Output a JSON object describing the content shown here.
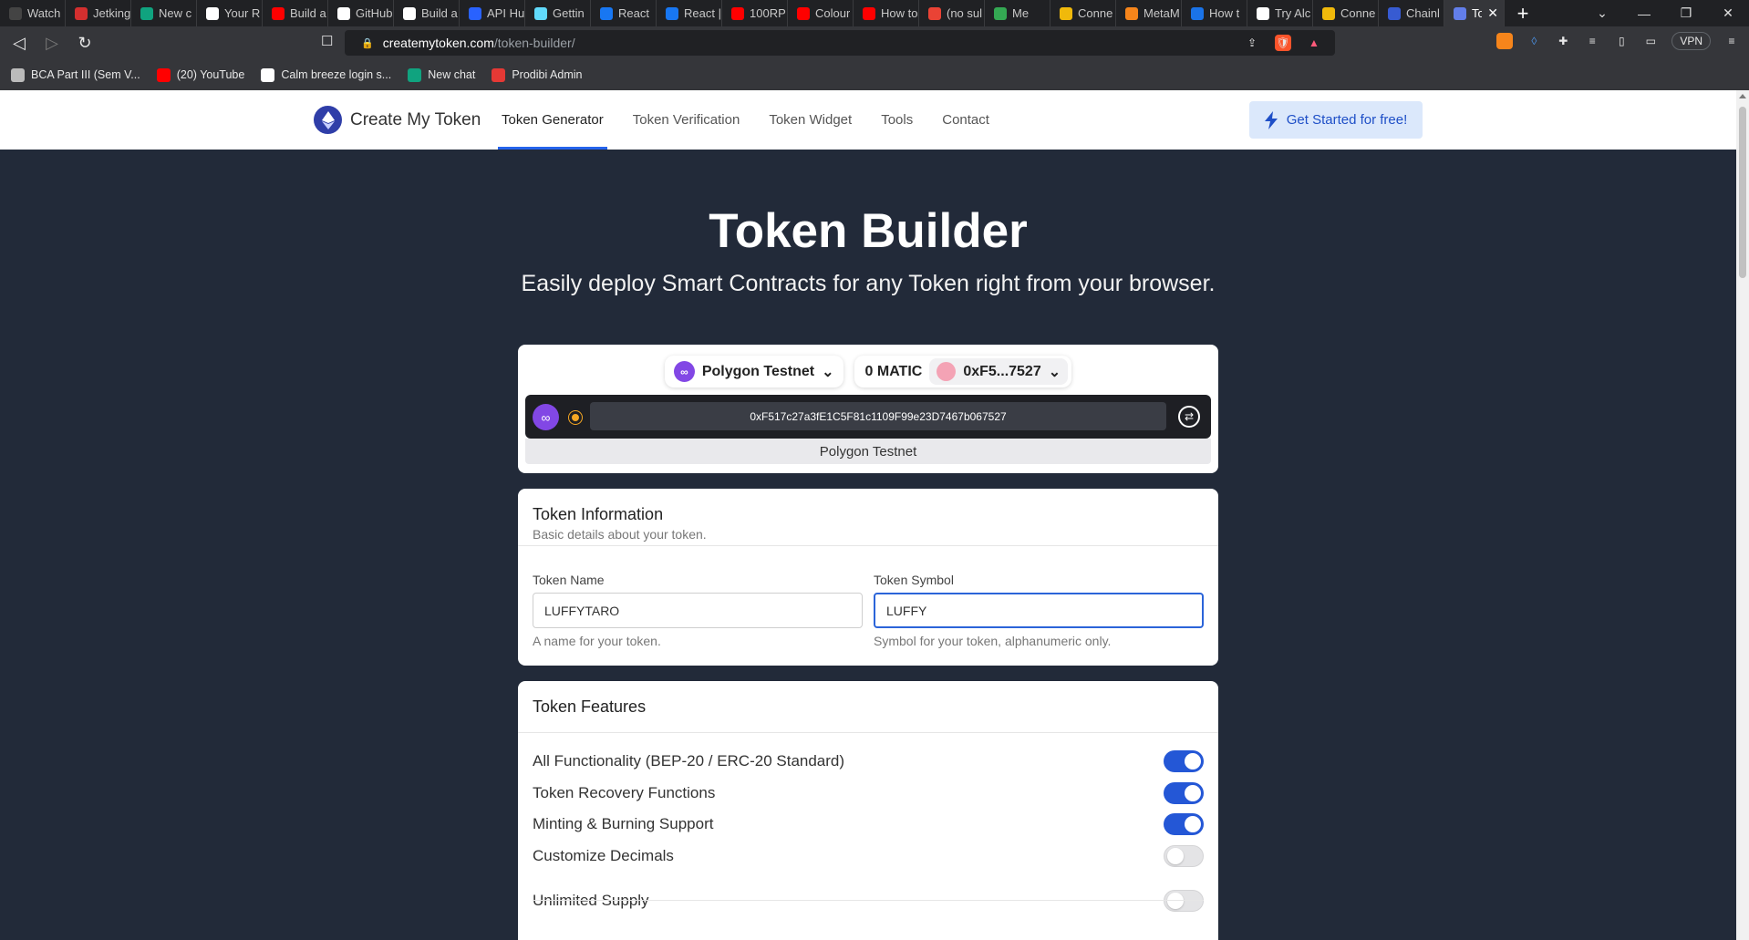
{
  "browser": {
    "tabs": [
      {
        "title": "Watch",
        "color": "#444"
      },
      {
        "title": "Jetking",
        "color": "#d32f2f"
      },
      {
        "title": "New c",
        "color": "#10a37f"
      },
      {
        "title": "Your R",
        "color": "#ffffff"
      },
      {
        "title": "Build a",
        "color": "#ff0000"
      },
      {
        "title": "GitHub",
        "color": "#ffffff"
      },
      {
        "title": "Build a",
        "color": "#ffffff"
      },
      {
        "title": "API Hu",
        "color": "#2962ff"
      },
      {
        "title": "Gettin",
        "color": "#61dafb"
      },
      {
        "title": "React",
        "color": "#1877f2"
      },
      {
        "title": "React |",
        "color": "#1877f2"
      },
      {
        "title": "100RP",
        "color": "#ff0000"
      },
      {
        "title": "Colour",
        "color": "#ff0000"
      },
      {
        "title": "How to",
        "color": "#ff0000"
      },
      {
        "title": "(no sul",
        "color": "#ea4335"
      },
      {
        "title": "Me",
        "color": "#34a853"
      },
      {
        "title": "Conne",
        "color": "#f0b90b"
      },
      {
        "title": "MetaM",
        "color": "#f6851b"
      },
      {
        "title": "How t",
        "color": "#1a73e8"
      },
      {
        "title": "Try Alc",
        "color": "#ffffff"
      },
      {
        "title": "Conne",
        "color": "#f0b90b"
      },
      {
        "title": "Chainl",
        "color": "#375bd2"
      }
    ],
    "active_tab": {
      "title": "Tol"
    },
    "url_host": "createmytoken.com",
    "url_path": "/token-builder/",
    "vpn_label": "VPN",
    "bookmarks": [
      {
        "label": "BCA Part III (Sem V...",
        "color": "#bbbbbb"
      },
      {
        "label": "(20) YouTube",
        "color": "#ff0000"
      },
      {
        "label": "Calm breeze login s...",
        "color": "#ffffff"
      },
      {
        "label": "New chat",
        "color": "#10a37f"
      },
      {
        "label": "Prodibi Admin",
        "color": "#e53935"
      }
    ]
  },
  "site": {
    "brand": "Create My Token",
    "nav": [
      {
        "label": "Token Generator",
        "active": true
      },
      {
        "label": "Token Verification",
        "active": false
      },
      {
        "label": "Token Widget",
        "active": false
      },
      {
        "label": "Tools",
        "active": false
      },
      {
        "label": "Contact",
        "active": false
      }
    ],
    "cta_label": "Get Started for free!",
    "accent": "#2563eb"
  },
  "hero": {
    "title": "Token Builder",
    "subtitle": "Easily deploy Smart Contracts for any Token right from your browser."
  },
  "wallet": {
    "network": "Polygon Testnet",
    "balance": "0 MATIC",
    "account_short": "0xF5...7527",
    "address": "0xF517c27a3fE1C5F81c1109F99e23D7467b067527",
    "network_label": "Polygon Testnet"
  },
  "token_info": {
    "title": "Token Information",
    "subtitle": "Basic details about your token.",
    "name_label": "Token Name",
    "name_value": "LUFFYTARO",
    "name_help": "A name for your token.",
    "symbol_label": "Token Symbol",
    "symbol_value": "LUFFY",
    "symbol_help": "Symbol for your token, alphanumeric only."
  },
  "features": {
    "title": "Token Features",
    "items": [
      {
        "label": "All Functionality (BEP-20 / ERC-20 Standard)",
        "enabled": true
      },
      {
        "label": "Token Recovery Functions",
        "enabled": true
      },
      {
        "label": "Minting & Burning Support",
        "enabled": true
      },
      {
        "label": "Customize Decimals",
        "enabled": false
      },
      {
        "label": "Unlimited Supply",
        "enabled": false
      }
    ]
  }
}
